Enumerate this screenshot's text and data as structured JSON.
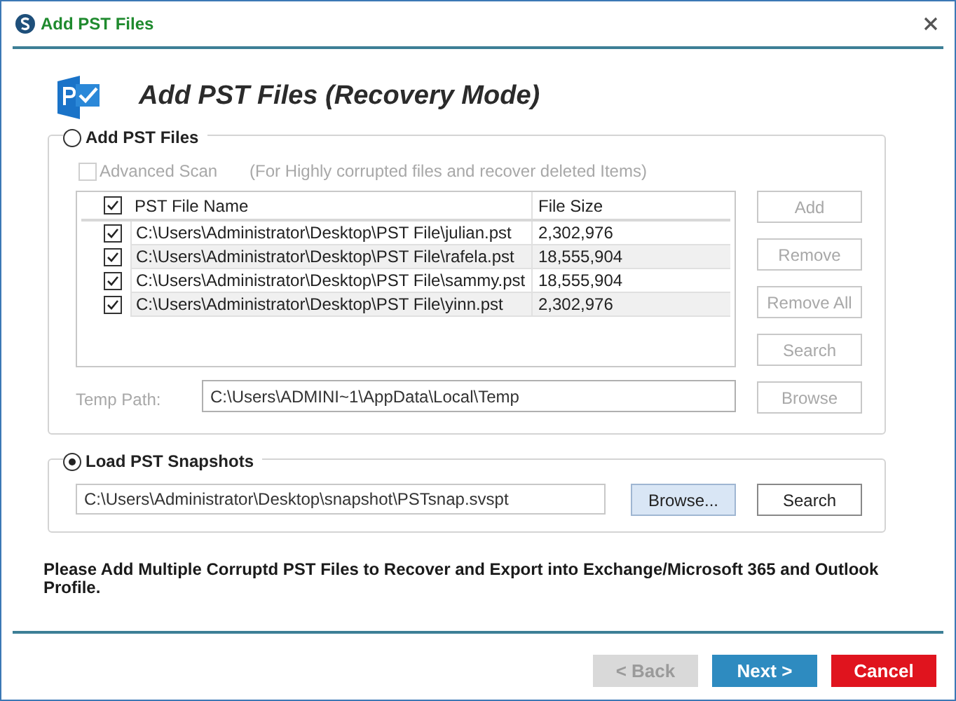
{
  "window": {
    "title": "Add PST Files"
  },
  "heading": "Add PST Files (Recovery Mode)",
  "add_section": {
    "label": "Add PST Files",
    "selected": false,
    "advanced_scan": {
      "label": "Advanced Scan",
      "checked": false,
      "disabled": true
    },
    "advanced_note": "(For Highly corrupted files and recover deleted Items)",
    "table": {
      "all_checked": true,
      "columns": [
        "PST File Name",
        "File Size"
      ],
      "rows": [
        {
          "checked": true,
          "name": "C:\\Users\\Administrator\\Desktop\\PST File\\julian.pst",
          "size": "2,302,976"
        },
        {
          "checked": true,
          "name": "C:\\Users\\Administrator\\Desktop\\PST File\\rafela.pst",
          "size": "18,555,904"
        },
        {
          "checked": true,
          "name": "C:\\Users\\Administrator\\Desktop\\PST File\\sammy.pst",
          "size": "18,555,904"
        },
        {
          "checked": true,
          "name": "C:\\Users\\Administrator\\Desktop\\PST File\\yinn.pst",
          "size": "2,302,976"
        }
      ]
    },
    "buttons": [
      {
        "label": "Add",
        "disabled": true
      },
      {
        "label": "Remove",
        "disabled": true
      },
      {
        "label": "Remove All",
        "disabled": true
      },
      {
        "label": "Search",
        "disabled": true
      }
    ],
    "temp_path": {
      "label": "Temp Path:",
      "value": "C:\\Users\\ADMINI~1\\AppData\\Local\\Temp"
    },
    "browse": {
      "label": "Browse",
      "disabled": true
    }
  },
  "snapshot_section": {
    "label": "Load PST Snapshots",
    "selected": true,
    "path": "C:\\Users\\Administrator\\Desktop\\snapshot\\PSTsnap.svspt",
    "buttons": [
      {
        "label": "Browse...",
        "highlighted": true
      },
      {
        "label": "Search",
        "highlighted": false
      }
    ]
  },
  "message": "Please Add Multiple Corruptd PST Files to Recover and Export into Exchange/Microsoft 365 and Outlook Profile.",
  "footer_buttons": [
    {
      "kind": "back",
      "label": "< Back",
      "disabled": true
    },
    {
      "kind": "next",
      "label": "Next >",
      "disabled": false
    },
    {
      "kind": "cancel",
      "label": "Cancel",
      "disabled": false
    }
  ]
}
